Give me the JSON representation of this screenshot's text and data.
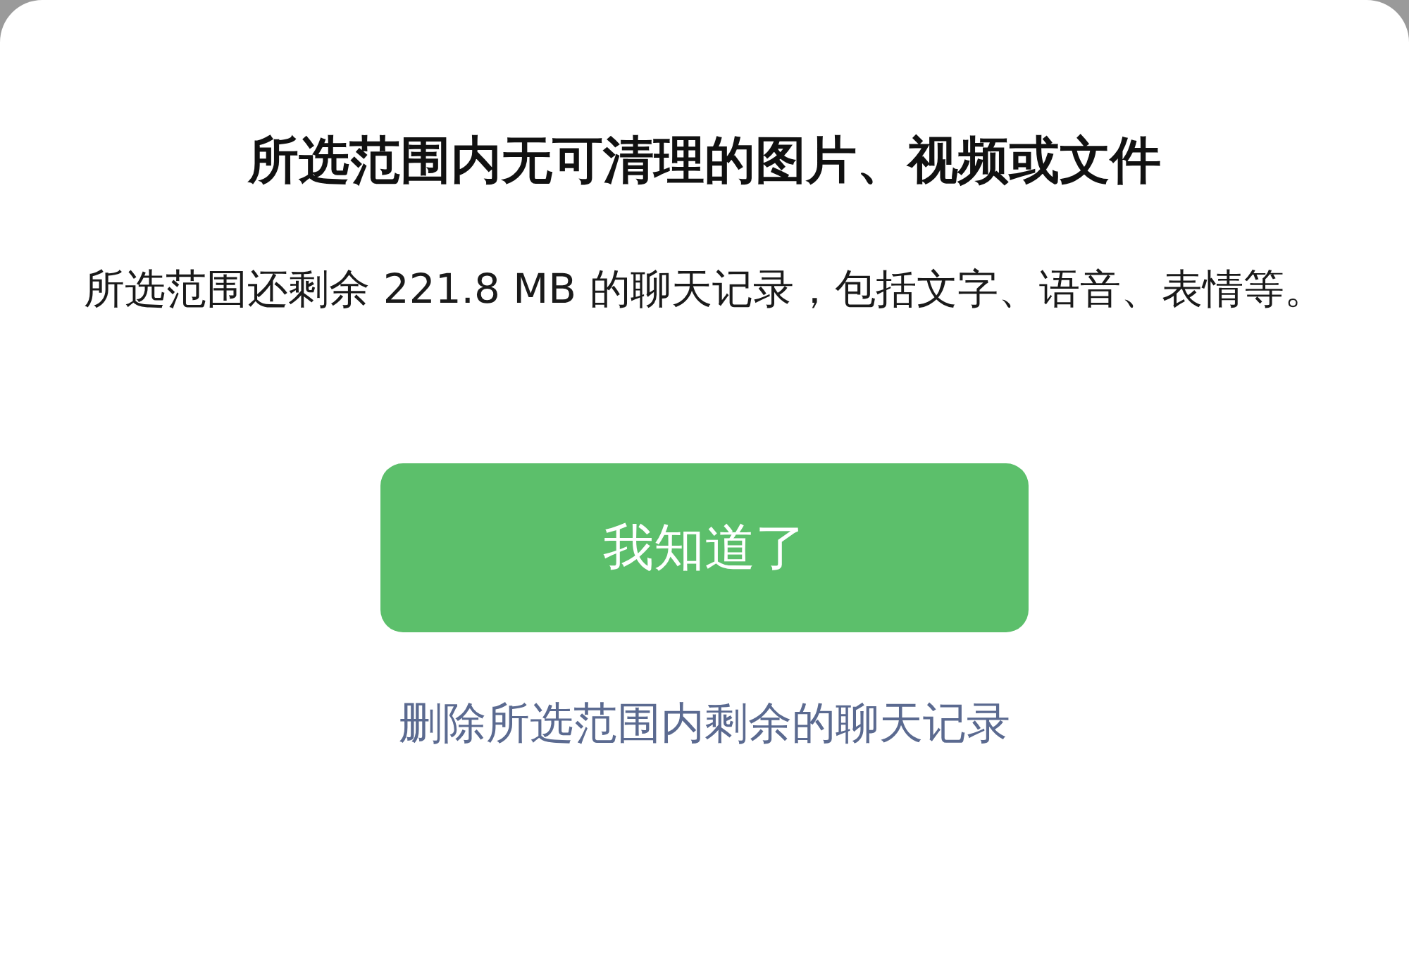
{
  "dialog": {
    "title": "所选范围内无可清理的图片、视频或文件",
    "message": "所选范围还剩余 221.8 MB 的聊天记录，包括文字、语音、表情等。",
    "confirm_button": "我知道了",
    "delete_link": "删除所选范围内剩余的聊天记录"
  }
}
